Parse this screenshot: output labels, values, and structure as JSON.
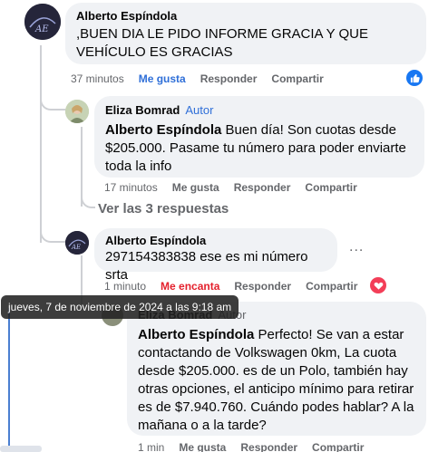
{
  "comments": [
    {
      "author": "Alberto Espíndola",
      "text": ",BUEN DIA LE PIDO INFORME GRACIA Y QUE VEHÍCULO ES GRACIAS",
      "time": "37 minutos",
      "like": "Me gusta",
      "reply": "Responder",
      "share": "Compartir",
      "reaction": "like"
    },
    {
      "author": "Eliza Bomrad",
      "badge": "Autor",
      "mention": "Alberto Espíndola",
      "text": " Buen día! Son cuotas desde $205.000. Pasame tu número para poder enviarte toda la info",
      "time": "17 minutos",
      "like": "Me gusta",
      "reply": "Responder",
      "share": "Compartir"
    },
    {
      "author": "Alberto Espíndola",
      "text": "297154383838 ese es mi número srta",
      "time": "1 minuto",
      "like": "Me encanta",
      "reply": "Responder",
      "share": "Compartir",
      "reaction": "love"
    },
    {
      "author": "Eliza Bomrad",
      "badge": "Autor",
      "mention": "Alberto Espíndola",
      "text": " Perfecto! Se van a estar contactando de Volkswagen 0km, La cuota desde $205.000. es de un Polo, también hay otras opciones, el anticipo mínimo para retirar es de $7.940.760. Cuándo podes hablar? A la mañana o a la tarde?",
      "time": "1 min",
      "like": "Me gusta",
      "reply": "Responder",
      "share": "Compartir"
    }
  ],
  "view_replies": "Ver las 3 respuestas",
  "tooltip": "jueves, 7 de noviembre de 2024 a las 9:18 am",
  "more_options": "...",
  "colors": {
    "like_blue": "#1877f2",
    "love_red": "#f33e58",
    "link_blue": "#2f6fd8",
    "muted": "#65676b"
  }
}
